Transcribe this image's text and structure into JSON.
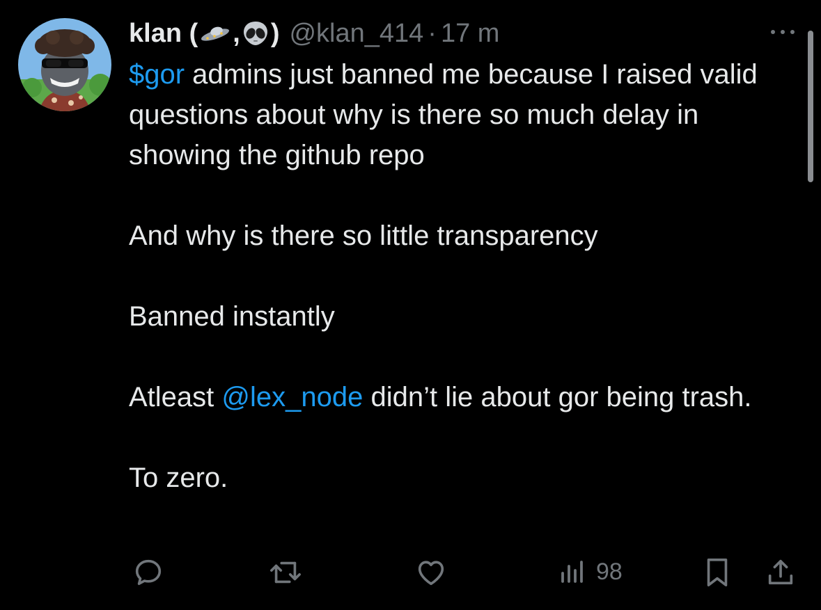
{
  "tweet": {
    "author": {
      "name_prefix": "klan (",
      "name_emoji_1": "flying-saucer-emoji",
      "name_separator": ",",
      "name_emoji_2": "alien-emoji",
      "name_suffix": ")",
      "handle": "@klan_414",
      "separator": "·",
      "time": "17 m"
    },
    "text": {
      "line1_cashtag": "$gor",
      "line1_rest": " admins just banned me because I raised valid questions about why is there so much delay in showing the github repo",
      "line2": "And why is there so little transparency",
      "line3": "Banned instantly",
      "line4_pre": "Atleast ",
      "line4_mention": "@lex_node",
      "line4_post": " didn’t lie about gor being trash.",
      "line5": "To zero."
    },
    "actions": {
      "reply": "reply-icon",
      "retweet": "retweet-icon",
      "like": "heart-icon",
      "views_icon": "analytics-icon",
      "views_count": "98",
      "bookmark": "bookmark-icon",
      "share": "share-icon"
    },
    "colors": {
      "background": "#000000",
      "text": "#e7e9ea",
      "muted": "#71767b",
      "accent": "#1d9bf0"
    }
  }
}
